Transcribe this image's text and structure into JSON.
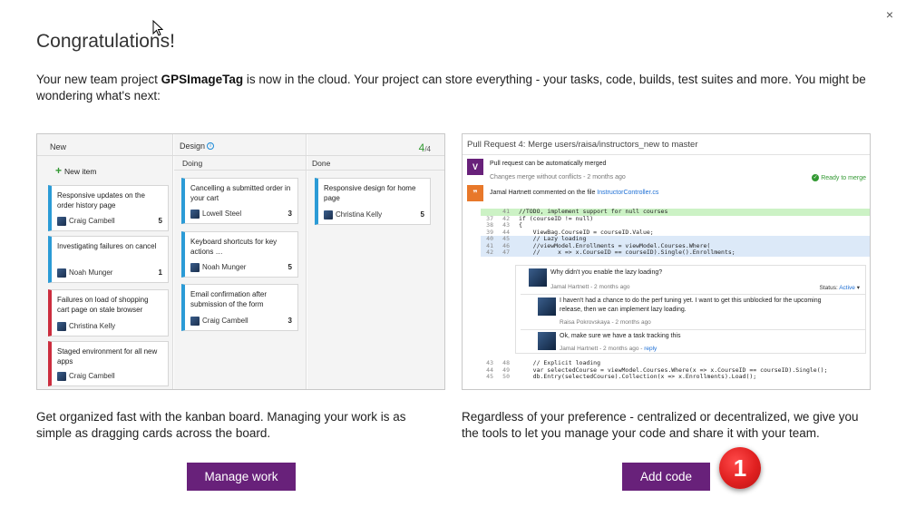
{
  "dialog": {
    "close_label": "×",
    "title": "Congratulations!",
    "intro_prefix": "Your new team project ",
    "project_name": "GPSImageTag",
    "intro_suffix": " is now in the cloud. Your project can store everything - your tasks, code, builds, test suites and more. You might be wondering what's next:"
  },
  "kanban": {
    "col_new": "New",
    "col_design": "Design",
    "count_main": "4",
    "count_total": "/4",
    "sub_doing": "Doing",
    "sub_done": "Done",
    "new_item_label": "New item",
    "cards": [
      {
        "title": "Responsive updates on the order history page",
        "person": "Craig Cambell",
        "points": "5",
        "color": "#2b9bd6"
      },
      {
        "title": "Investigating failures on cancel",
        "person": "Noah Munger",
        "points": "1",
        "color": "#2b9bd6"
      },
      {
        "title": "Failures on load of shopping cart page on stale browser",
        "person": "Christina Kelly",
        "points": "",
        "color": "#cc2d3e"
      },
      {
        "title": "Staged environment for all new apps",
        "person": "Craig Cambell",
        "points": "",
        "color": "#cc2d3e"
      },
      {
        "title": "Cancelling a submitted order in your cart",
        "person": "Lowell Steel",
        "points": "3",
        "color": "#2b9bd6"
      },
      {
        "title": "Keyboard shortcuts for key actions …",
        "person": "Noah Munger",
        "points": "5",
        "color": "#2b9bd6"
      },
      {
        "title": "Email confirmation after submission of the form",
        "person": "Craig Cambell",
        "points": "3",
        "color": "#2b9bd6"
      },
      {
        "title": "Responsive design for home page",
        "person": "Christina Kelly",
        "points": "5",
        "color": "#2b9bd6"
      }
    ]
  },
  "pr": {
    "title": "Pull Request 4: Merge users/raisa/instructors_new to master",
    "merge_status": "Pull request can be automatically merged",
    "merge_sub": "Changes merge without conflicts - 2 months ago",
    "ready_label": "Ready to merge",
    "comment_head_prefix": "Jamal Hartnett commented on the file ",
    "comment_file": "InstructorController.cs",
    "code_top": [
      {
        "l1": "",
        "l2": "41",
        "text": "//TODO, implement support for null courses",
        "kind": "add"
      },
      {
        "l1": "37",
        "l2": "42",
        "text": "if (courseID != null)",
        "kind": ""
      },
      {
        "l1": "38",
        "l2": "43",
        "text": "{",
        "kind": ""
      },
      {
        "l1": "39",
        "l2": "44",
        "text": "    ViewBag.CourseID = courseID.Value;",
        "kind": ""
      },
      {
        "l1": "40",
        "l2": "45",
        "text": "    // Lazy loading",
        "kind": "sel"
      },
      {
        "l1": "41",
        "l2": "46",
        "text": "    //viewModel.Enrollments = viewModel.Courses.Where(",
        "kind": "sel"
      },
      {
        "l1": "42",
        "l2": "47",
        "text": "    //     x => x.CourseID == courseID).Single().Enrollments;",
        "kind": "sel"
      }
    ],
    "thread_question": "Why didn't you enable the lazy loading?",
    "thread_question_meta": "Jamal Hartnett - 2 months ago",
    "status_label": "Status:",
    "status_value": "Active",
    "reply1": "I haven't had a chance to do the perf tuning yet. I want to get this unblocked for the upcoming release, then we can implement lazy loading.",
    "reply1_meta": "Raisa Pokrovskaya - 2 months ago",
    "reply2": "Ok, make sure we have a task tracking this",
    "reply2_meta": "Jamal Hartnett - 2 months ago - ",
    "reply_link": "reply",
    "code_bottom": [
      {
        "l1": "43",
        "l2": "48",
        "text": "    // Explicit loading",
        "kind": ""
      },
      {
        "l1": "44",
        "l2": "49",
        "text": "    var selectedCourse = viewModel.Courses.Where(x => x.CourseID == courseID).Single();",
        "kind": ""
      },
      {
        "l1": "45",
        "l2": "50",
        "text": "    db.Entry(selectedCourse).Collection(x => x.Enrollments).Load();",
        "kind": ""
      }
    ]
  },
  "bottom": {
    "left_desc": "Get organized fast with the kanban board. Managing your work is as simple as dragging cards across the board.",
    "right_desc": "Regardless of your preference - centralized or decentralized, we give you the tools to let you manage your code and share it with your team.",
    "manage_work_label": "Manage work",
    "add_code_label": "Add code",
    "callout_number": "1"
  },
  "colors": {
    "accent_purple": "#68217a",
    "kanban_blue": "#2b9bd6",
    "kanban_red": "#cc2d3e",
    "success_green": "#339933",
    "callout_red": "#e02020"
  }
}
